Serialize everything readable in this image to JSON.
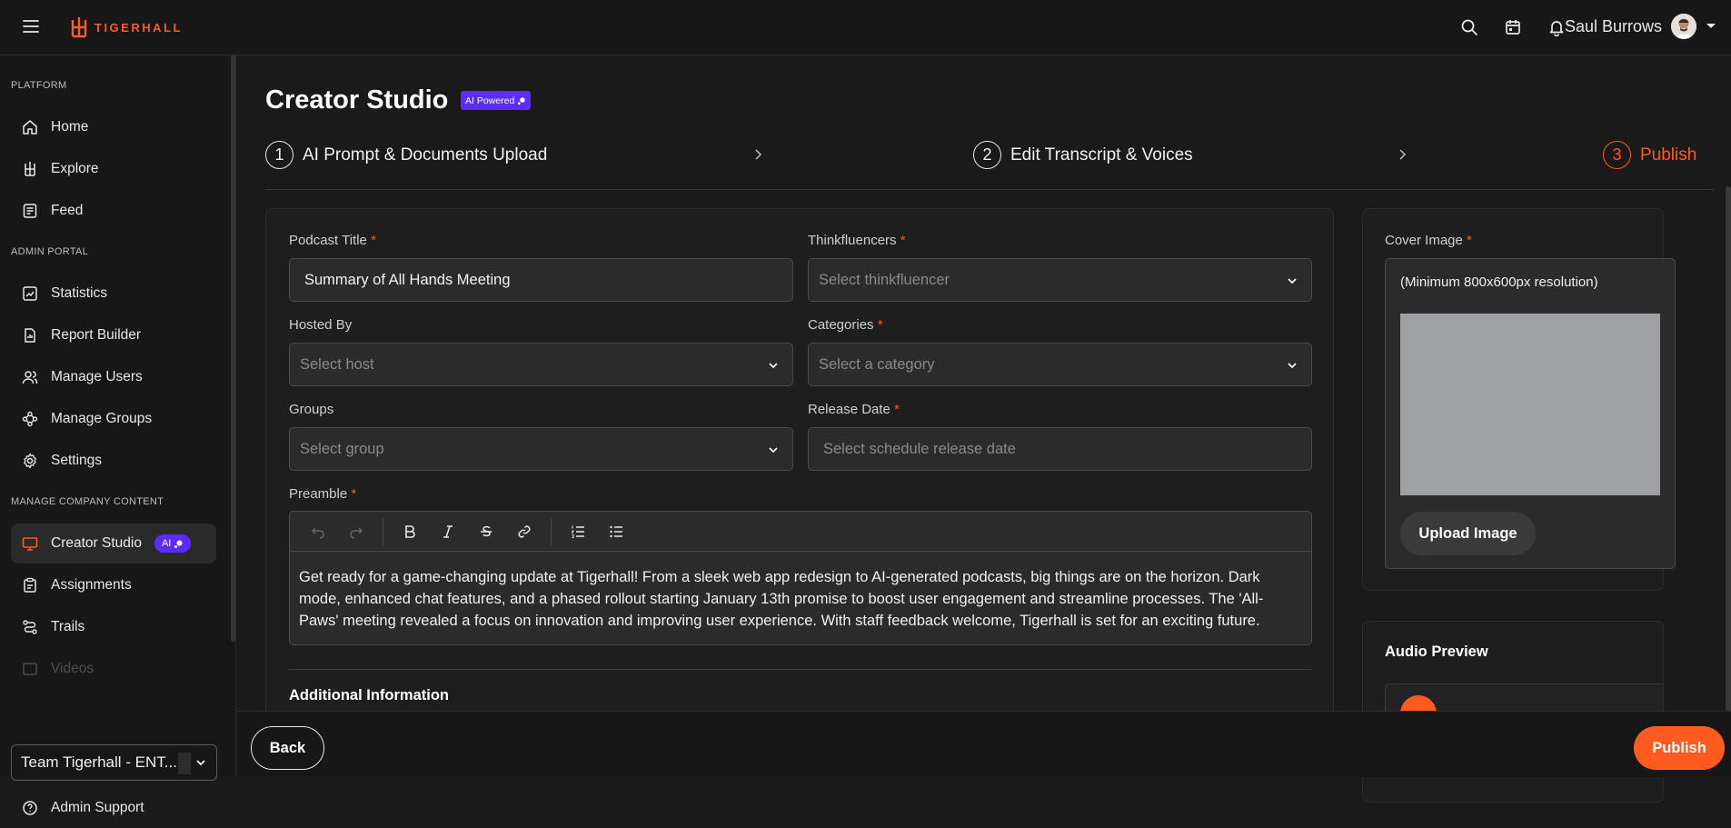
{
  "app": {
    "brand": "TIGERHALL",
    "accent": "#ff5a1f",
    "ai_color": "#5b2bff"
  },
  "header": {
    "icons": [
      "search-icon",
      "calendar-icon",
      "bell-icon"
    ],
    "user_name": "Saul Burrows"
  },
  "sidebar": {
    "sections": {
      "platform": "PLATFORM",
      "admin": "ADMIN PORTAL",
      "company": "MANAGE COMPANY CONTENT"
    },
    "items": {
      "home": "Home",
      "explore": "Explore",
      "feed": "Feed",
      "statistics": "Statistics",
      "report_builder": "Report Builder",
      "manage_users": "Manage Users",
      "manage_groups": "Manage Groups",
      "settings": "Settings",
      "creator_studio": "Creator Studio",
      "assignments": "Assignments",
      "trails": "Trails",
      "videos": "Videos",
      "admin_support": "Admin Support"
    },
    "ai_badge": "AI",
    "team": "Team Tigerhall - ENT..."
  },
  "page": {
    "title": "Creator Studio",
    "ai_powered": "AI Powered"
  },
  "stepper": {
    "steps": [
      {
        "num": "1",
        "label": "AI Prompt & Documents Upload"
      },
      {
        "num": "2",
        "label": "Edit Transcript & Voices"
      },
      {
        "num": "3",
        "label": "Publish"
      }
    ],
    "active_step": 3
  },
  "form": {
    "podcast_title": {
      "label": "Podcast Title",
      "value": "Summary of All Hands Meeting"
    },
    "thinkfluencers": {
      "label": "Thinkfluencers",
      "placeholder": "Select thinkfluencer"
    },
    "hosted_by": {
      "label": "Hosted By",
      "placeholder": "Select host"
    },
    "categories": {
      "label": "Categories",
      "placeholder": "Select a category"
    },
    "groups": {
      "label": "Groups",
      "placeholder": "Select group"
    },
    "release_date": {
      "label": "Release Date",
      "placeholder": "Select schedule release date"
    },
    "preamble": {
      "label": "Preamble",
      "text": "Get ready for a game-changing update at Tigerhall! From a sleek web app redesign to AI-generated podcasts, big things are on the horizon. Dark mode, enhanced chat features, and a phased rollout starting January 13th promise to boost user engagement and streamline processes. The 'All-Paws' meeting revealed a focus on innovation and improving user experience. With staff feedback welcome, Tigerhall is set for an exciting future."
    },
    "additional_info": "Additional Information",
    "required_mark": "*"
  },
  "cover": {
    "label": "Cover Image",
    "hint": "(Minimum 800x600px resolution)",
    "upload_label": "Upload Image"
  },
  "audio": {
    "title": "Audio Preview"
  },
  "footer": {
    "back_label": "Back",
    "publish_label": "Publish"
  }
}
